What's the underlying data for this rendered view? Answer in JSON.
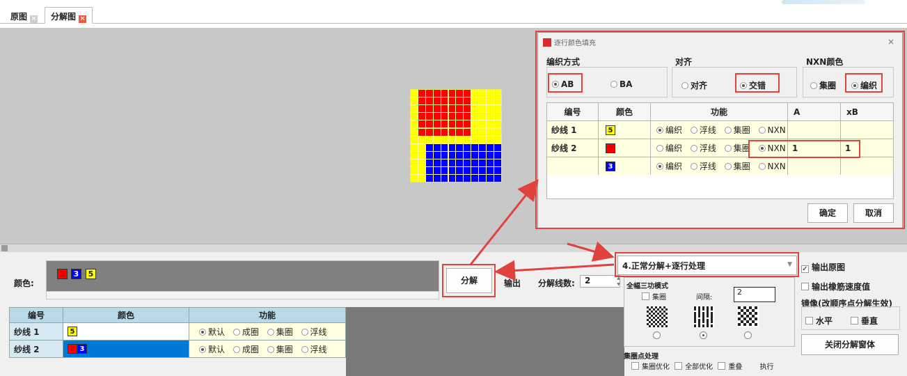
{
  "tabs": [
    {
      "label": "原图"
    },
    {
      "label": "分解图"
    }
  ],
  "bottom": {
    "color_label": "颜色:",
    "swatches": [
      {
        "label": "2",
        "bg": "#ff0000",
        "fg": "#cc0000"
      },
      {
        "label": "3",
        "bg": "#0000ff",
        "fg": "#ffffff"
      },
      {
        "label": "5",
        "bg": "#ffff00",
        "fg": "#222222"
      }
    ],
    "decompose_button": "分解",
    "output_label": "输出",
    "count_label": "分解线数:",
    "count_value": "2",
    "table": {
      "headers": [
        "编号",
        "颜色",
        "功能"
      ],
      "rows": [
        {
          "id": "纱线 1",
          "colors": [
            "5"
          ],
          "options": [
            "默认",
            "成圈",
            "集圈",
            "浮线"
          ],
          "selected": "默认"
        },
        {
          "id": "纱线 2",
          "colors": [
            "2",
            "3"
          ],
          "options": [
            "默认",
            "成圈",
            "集圈",
            "浮线"
          ],
          "selected": "默认"
        }
      ]
    }
  },
  "process": {
    "select_value": "4.正常分解+逐行处理",
    "tri_title": "全幅三功模式",
    "tuck_label": "集圈",
    "gap_label": "间隔:",
    "gap_value": "2",
    "tuckpt_title": "集圈点处理",
    "tuckpt_opt1": "集圈优化",
    "tuckpt_opt2": "全部优化",
    "tuckpt_opt3": "重叠",
    "tuckpt_exec": "执行"
  },
  "right_panel": {
    "output_original": "输出原图",
    "output_rubber": "输出橡筋速度值",
    "mirror_title": "镜像(改顺序点分解生效)",
    "horizontal": "水平",
    "vertical": "垂直",
    "close_button": "关闭分解窗体"
  },
  "dialog": {
    "title": "逐行颜色填充",
    "close": "×",
    "weave_title": "编织方式",
    "weave_ab": "AB",
    "weave_ba": "BA",
    "align_title": "对齐",
    "align_opt1": "对齐",
    "align_opt2": "交错",
    "nxn_title": "NXN颜色",
    "nxn_opt1": "集圈",
    "nxn_opt2": "编织",
    "table": {
      "headers": [
        "编号",
        "颜色",
        "功能",
        "A",
        "xB"
      ],
      "rows": [
        {
          "id": "纱线 1",
          "color": "5",
          "selected": "编织",
          "a": "",
          "xb": ""
        },
        {
          "id": "纱线 2",
          "color": "2",
          "selected": "NXN",
          "a": "1",
          "xb": "1"
        },
        {
          "id": "",
          "color": "3",
          "selected": "编织",
          "a": "",
          "xb": ""
        }
      ],
      "options": [
        "编织",
        "浮线",
        "集圈",
        "NXN"
      ]
    },
    "ok_button": "确定",
    "cancel_button": "取消"
  },
  "colors": {
    "red": "#ff0000",
    "blue": "#0000ff",
    "yellow": "#ffff00",
    "highlight": "#e0423c",
    "table_header": "#b7d9e8"
  }
}
